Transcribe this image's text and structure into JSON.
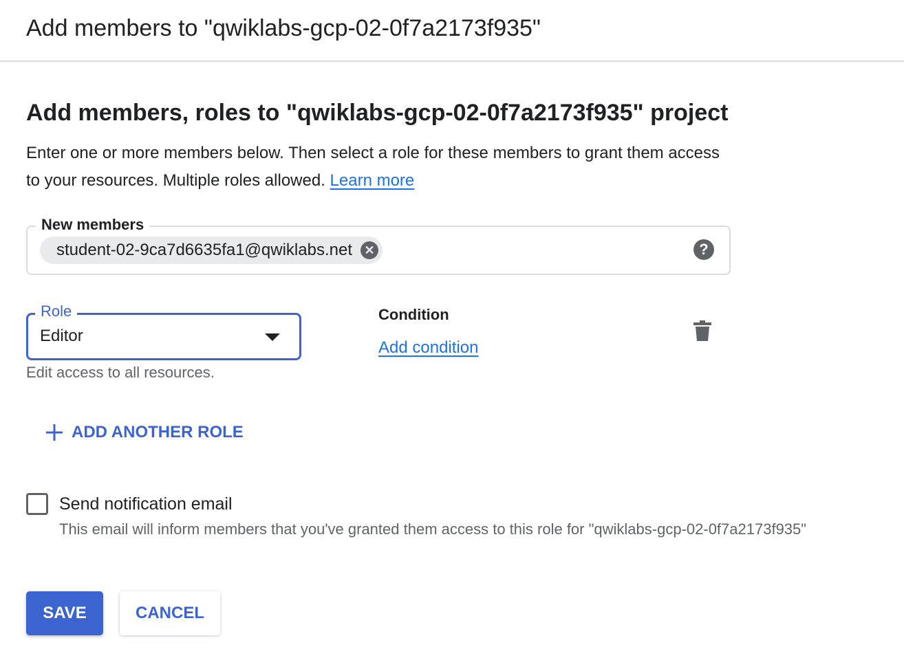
{
  "header": {
    "title": "Add members to \"qwiklabs-gcp-02-0f7a2173f935\""
  },
  "section": {
    "title": "Add members, roles to \"qwiklabs-gcp-02-0f7a2173f935\" project",
    "description": "Enter one or more members below. Then select a role for these members to grant them access to your resources. Multiple roles allowed.",
    "learn_more": "Learn more"
  },
  "members": {
    "label": "New members",
    "chips": [
      "student-02-9ca7d6635fa1@qwiklabs.net"
    ],
    "chip_remove_icon": "cancel-icon",
    "help_icon": "help-icon",
    "help_symbol": "?"
  },
  "role": {
    "label": "Role",
    "value": "Editor",
    "hint": "Edit access to all resources."
  },
  "condition": {
    "label": "Condition",
    "add_label": "Add condition",
    "delete_icon": "trash-icon"
  },
  "add_role": {
    "label": "ADD ANOTHER ROLE",
    "icon": "plus-icon"
  },
  "notification": {
    "checked": false,
    "label": "Send notification email",
    "hint": "This email will inform members that you've granted them access to this role for \"qwiklabs-gcp-02-0f7a2173f935\""
  },
  "buttons": {
    "save": "SAVE",
    "cancel": "CANCEL"
  },
  "colors": {
    "accent": "#3b64d1",
    "link": "#1a73e8",
    "text": "#202124",
    "secondary_text": "#5f6368",
    "border": "#dadce0",
    "chip_bg": "#e8eaed"
  }
}
